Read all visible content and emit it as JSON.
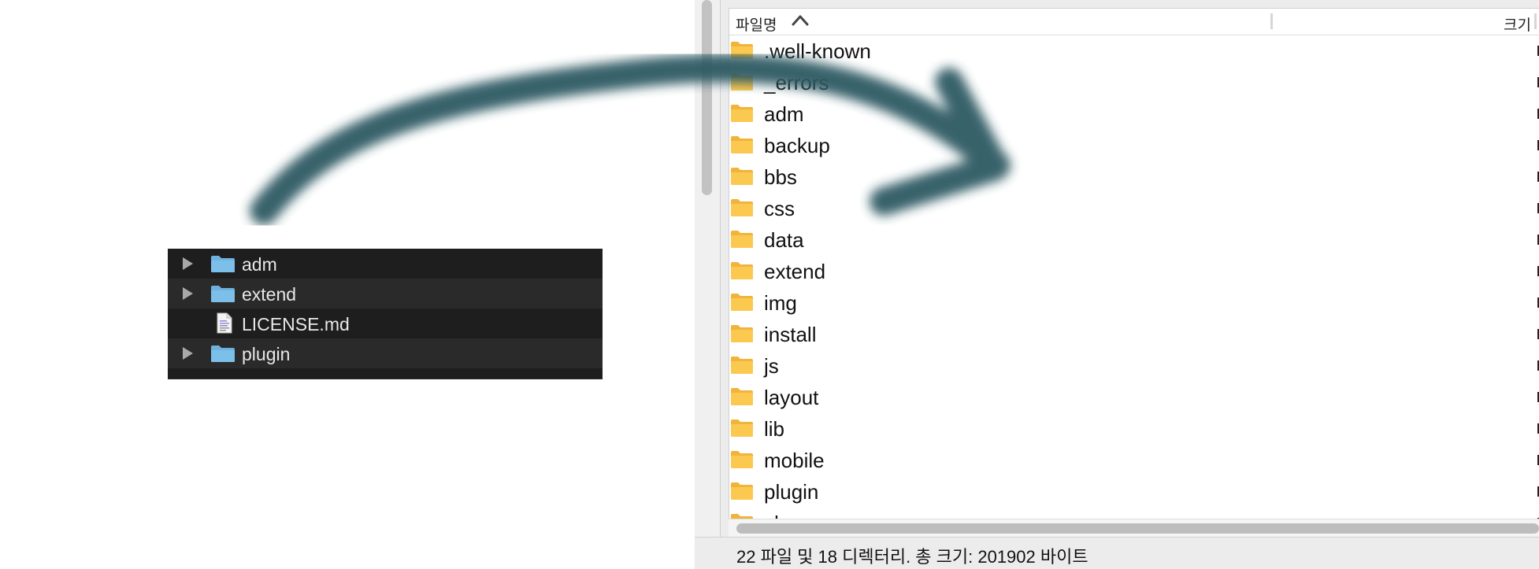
{
  "finder": {
    "items": [
      {
        "label": "adm",
        "kind": "folder"
      },
      {
        "label": "extend",
        "kind": "folder"
      },
      {
        "label": "LICENSE.md",
        "kind": "file"
      },
      {
        "label": "plugin",
        "kind": "folder"
      }
    ]
  },
  "file_manager": {
    "columns": {
      "name": "파일명",
      "size": "크기"
    },
    "rows": [
      ".well-known",
      "_errors",
      "adm",
      "backup",
      "bbs",
      "css",
      "data",
      "extend",
      "img",
      "install",
      "js",
      "layout",
      "lib",
      "mobile",
      "plugin",
      "shop"
    ],
    "status": "22 파일 및 18 디렉터리. 총 크기: 201902 바이트"
  },
  "colors": {
    "arrow": "#2f5a63",
    "folder_yellow": "#f8c646",
    "folder_blue": "#6fb1de"
  }
}
